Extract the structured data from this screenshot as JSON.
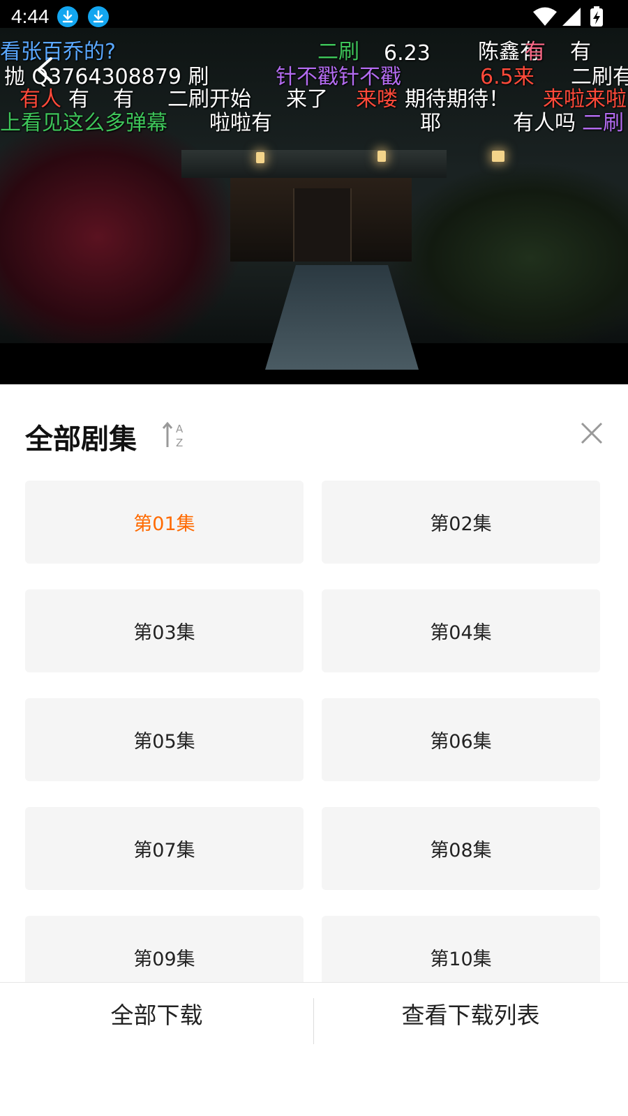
{
  "status_bar": {
    "time": "4:44",
    "left_icons": [
      "download-icon",
      "download-icon"
    ],
    "right_icons": [
      "wifi-icon",
      "signal-icon",
      "battery-charging-icon"
    ]
  },
  "danmaku": [
    {
      "text": "看张百乔的?",
      "color": "#5aa8ff"
    },
    {
      "text": "二刷",
      "color": "#3ec45a"
    },
    {
      "text": "6.23",
      "color": "#ffffff"
    },
    {
      "text": "陈鑫有",
      "color": "#ffffff"
    },
    {
      "text": "有",
      "color": "#ff6b8a"
    },
    {
      "text": "有",
      "color": "#ffffff"
    },
    {
      "text": "抛 Q3764308879 刷",
      "color": "#ffffff"
    },
    {
      "text": "针不戳针不戳",
      "color": "#b36cf0"
    },
    {
      "text": "6.5来",
      "color": "#ff4a3a"
    },
    {
      "text": "二刷有",
      "color": "#ffffff"
    },
    {
      "text": "有人",
      "color": "#ff4a3a"
    },
    {
      "text": "有",
      "color": "#ffffff"
    },
    {
      "text": "有",
      "color": "#ffffff"
    },
    {
      "text": "二刷开始",
      "color": "#ffffff"
    },
    {
      "text": "来了",
      "color": "#ffffff"
    },
    {
      "text": "来喽",
      "color": "#ff4a3a"
    },
    {
      "text": "期待期待！",
      "color": "#ffffff"
    },
    {
      "text": "来啦来啦",
      "color": "#ff4a3a"
    },
    {
      "text": "上看见这么多弹幕",
      "color": "#3ec45a"
    },
    {
      "text": "啦啦有",
      "color": "#ffffff"
    },
    {
      "text": "耶",
      "color": "#ffffff"
    },
    {
      "text": "有人吗",
      "color": "#ffffff"
    },
    {
      "text": "二刷",
      "color": "#b36cf0"
    }
  ],
  "panel": {
    "title": "全部剧集",
    "sort_icon": "sort-az-icon",
    "close_icon": "close-icon",
    "active_color": "#ff6a00"
  },
  "episodes": [
    {
      "label": "第01集",
      "active": true
    },
    {
      "label": "第02集",
      "active": false
    },
    {
      "label": "第03集",
      "active": false
    },
    {
      "label": "第04集",
      "active": false
    },
    {
      "label": "第05集",
      "active": false
    },
    {
      "label": "第06集",
      "active": false
    },
    {
      "label": "第07集",
      "active": false
    },
    {
      "label": "第08集",
      "active": false
    },
    {
      "label": "第09集",
      "active": false
    },
    {
      "label": "第10集",
      "active": false
    }
  ],
  "bottom": {
    "download_all": "全部下载",
    "view_list": "查看下载列表"
  }
}
